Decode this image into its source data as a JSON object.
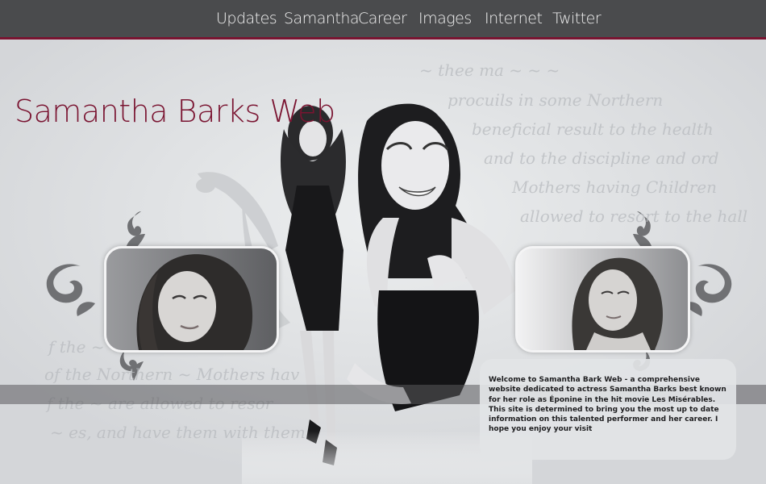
{
  "nav": {
    "items": [
      {
        "label": "Updates"
      },
      {
        "label": "Samantha"
      },
      {
        "label": "Career"
      },
      {
        "label": "Images"
      },
      {
        "label": "Internet"
      },
      {
        "label": "Twitter"
      }
    ]
  },
  "site": {
    "title": "Samantha Barks Web"
  },
  "welcome": {
    "text": "Welcome to Samantha Bark Web - a comprehensive website dedicated to actress Samantha Barks best known for her role as Éponine in the hit movie  Les Misérables. This site is determined to bring you the most up to date information on this talented performer and her career. I hope you enjoy your visit"
  },
  "colors": {
    "accent": "#7a1431",
    "nav_bg": "#4a4b4d",
    "page_bg": "#d4d6d9"
  }
}
